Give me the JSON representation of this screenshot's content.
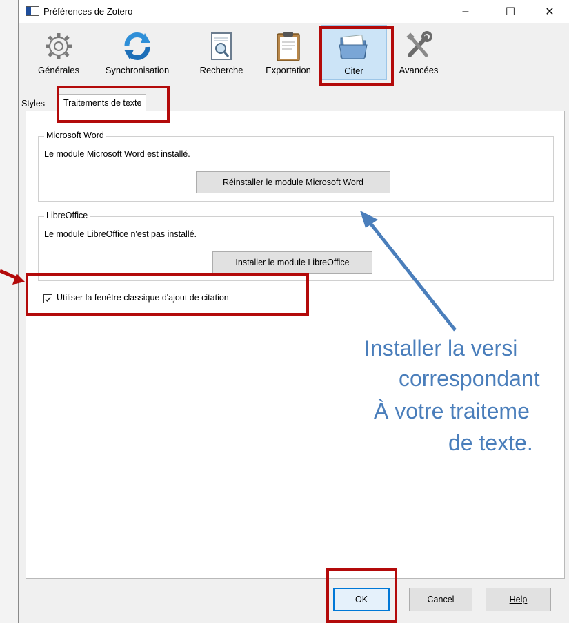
{
  "window": {
    "title": "Préférences de Zotero",
    "minimize": "–",
    "maximize": "☐",
    "close": "✕"
  },
  "toolbar": {
    "items": [
      {
        "label": "Générales",
        "icon": "gear-icon"
      },
      {
        "label": "Synchronisation",
        "icon": "sync-icon"
      },
      {
        "label": "Recherche",
        "icon": "search-document-icon"
      },
      {
        "label": "Exportation",
        "icon": "clipboard-icon"
      },
      {
        "label": "Citer",
        "icon": "folder-icon",
        "selected": true
      },
      {
        "label": "Avancées",
        "icon": "tools-icon"
      }
    ]
  },
  "tabs": {
    "styles": "Styles",
    "word_processors": "Traitements de texte"
  },
  "word": {
    "legend": "Microsoft Word",
    "status": "Le module Microsoft Word est installé.",
    "button": "Réinstaller le module Microsoft Word"
  },
  "libreoffice": {
    "legend": "LibreOffice",
    "status": "Le module LibreOffice n'est pas installé.",
    "button": "Installer le module LibreOffice"
  },
  "classic_citation": {
    "label": "Utiliser la fenêtre classique d'ajout de citation",
    "checked": true
  },
  "footer": {
    "ok": "OK",
    "cancel": "Cancel",
    "help": "Help"
  },
  "annotation": {
    "lines": [
      "Installer la versi",
      "correspondant",
      "À votre traiteme",
      "de texte."
    ]
  },
  "colors": {
    "highlight_box": "#b30a0a",
    "annotation": "#4a7ebb",
    "selected_tab": "#cce4f7"
  }
}
